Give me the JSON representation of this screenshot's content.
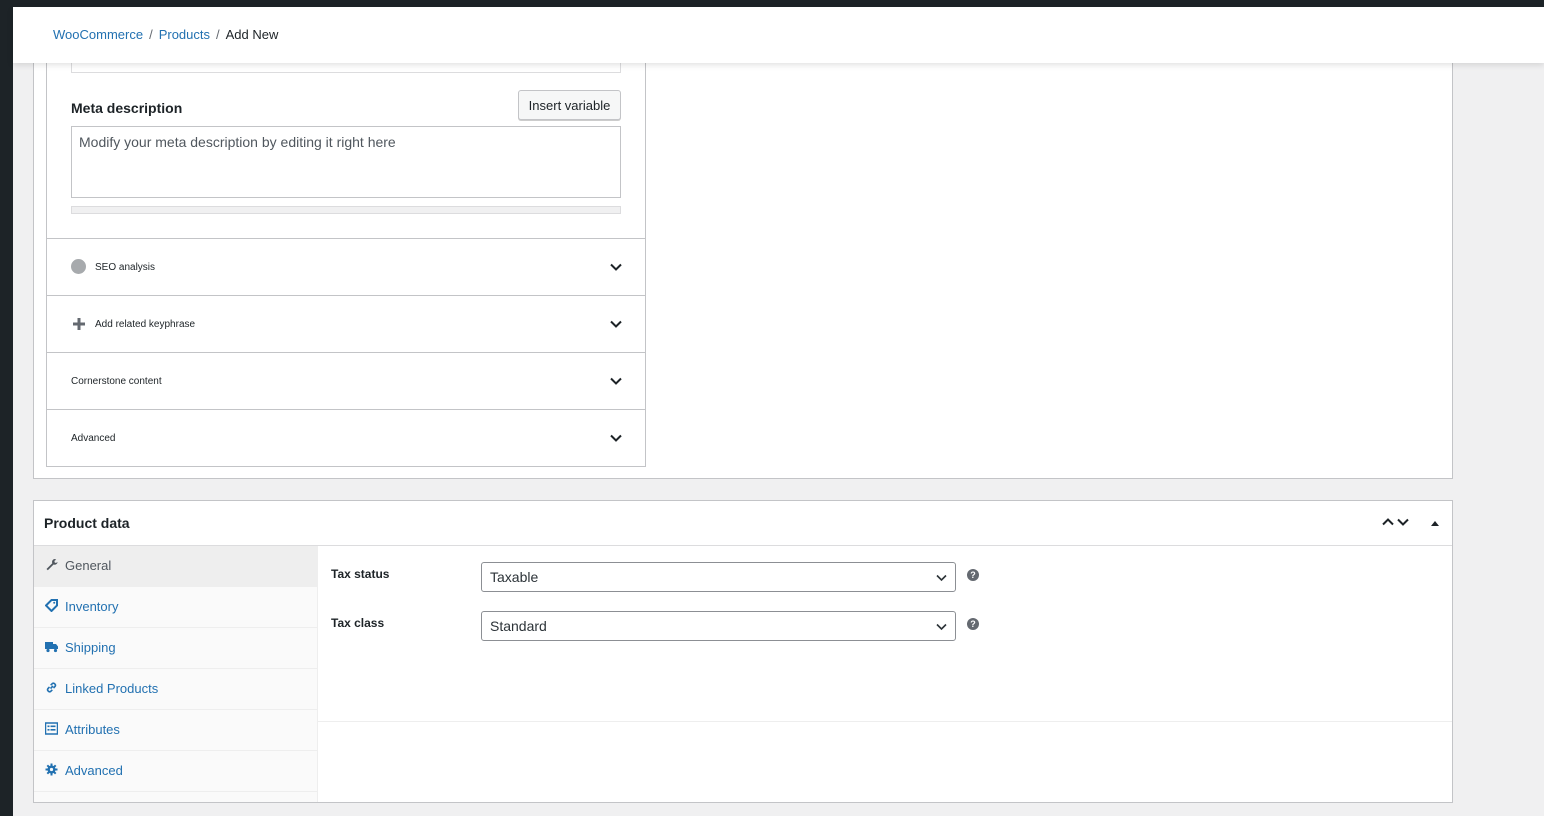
{
  "breadcrumb": {
    "items": [
      "WooCommerce",
      "Products"
    ],
    "current": "Add New"
  },
  "seo": {
    "meta_label": "Meta description",
    "insert_variable": "Insert variable",
    "meta_placeholder": "Modify your meta description by editing it right here",
    "sections": [
      "SEO analysis",
      "Add related keyphrase",
      "Cornerstone content",
      "Advanced"
    ]
  },
  "product_data": {
    "title": "Product data",
    "tabs": [
      "General",
      "Inventory",
      "Shipping",
      "Linked Products",
      "Attributes",
      "Advanced"
    ],
    "active_tab": "General",
    "tax_status_label": "Tax status",
    "tax_status_value": "Taxable",
    "tax_class_label": "Tax class",
    "tax_class_value": "Standard",
    "help_glyph": "?"
  },
  "colors": {
    "link": "#2271b1",
    "admin_bar": "#1d2327",
    "background": "#f0f0f1"
  }
}
